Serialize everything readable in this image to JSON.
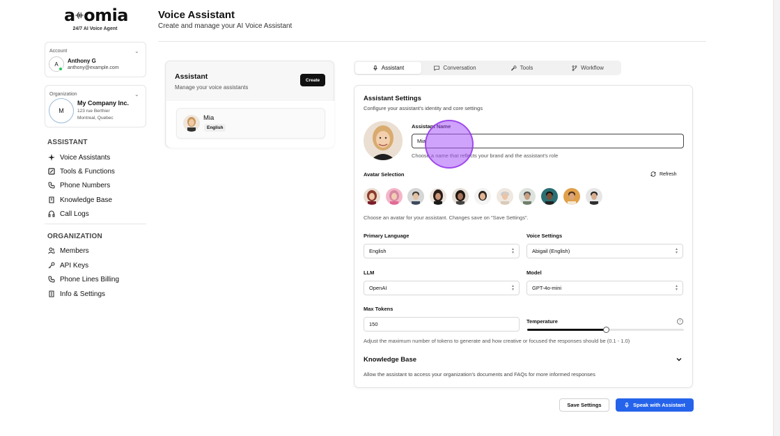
{
  "brand": {
    "logo_left": "a",
    "logo_right": "omia",
    "tagline": "24/7 AI Voice Agent"
  },
  "account": {
    "label": "Account",
    "initial": "A",
    "name": "Anthony G",
    "email": "anthony@example.com"
  },
  "organization": {
    "label": "Organization",
    "initial": "M",
    "name": "My Company Inc.",
    "address1": "123 rue Berthier",
    "address2": "Montreal, Quebec"
  },
  "nav": {
    "assistant_section": "ASSISTANT",
    "assistant_items": [
      "Voice Assistants",
      "Tools & Functions",
      "Phone Numbers",
      "Knowledge Base",
      "Call Logs"
    ],
    "org_section": "ORGANIZATION",
    "org_items": [
      "Members",
      "API Keys",
      "Phone Lines Billing",
      "Info & Settings"
    ]
  },
  "header": {
    "title": "Voice Assistant",
    "subtitle": "Create and manage your AI Voice Assistant"
  },
  "list": {
    "title": "Assistant",
    "subtitle": "Manage your voice assistants",
    "create_label": "Create",
    "items": [
      {
        "name": "Mia",
        "language": "English"
      }
    ]
  },
  "tabs": [
    "Assistant",
    "Conversation",
    "Tools",
    "Workflow"
  ],
  "settings": {
    "title": "Assistant Settings",
    "subtitle": "Configure your assistant's identity and core settings",
    "name_label": "Assistant Name",
    "name_value": "Mia",
    "name_hint": "Choose a name that reflects your brand and the assistant's role",
    "avatar_label": "Avatar Selection",
    "refresh_label": "Refresh",
    "avatar_hint": "Choose an avatar for your assistant. Changes save on \"Save Settings\".",
    "primary_language_label": "Primary Language",
    "primary_language_value": "English",
    "voice_label": "Voice Settings",
    "voice_value": "Abigail (English)",
    "llm_label": "LLM",
    "llm_value": "OpenAI",
    "model_label": "Model",
    "model_value": "GPT-4o-mini",
    "max_tokens_label": "Max Tokens",
    "max_tokens_value": "150",
    "temperature_label": "Temperature",
    "temperature_fraction": 0.5,
    "tokens_hint": "Adjust the maximum number of tokens to generate and how creative or focused the responses should be (0.1 - 1.0)",
    "kb_title": "Knowledge Base",
    "kb_subtitle": "Allow the assistant to access your organization's documents and FAQs for more informed responses"
  },
  "actions": {
    "save_label": "Save Settings",
    "speak_label": "Speak with Assistant"
  },
  "colors": {
    "accent": "#2563eb",
    "online": "#22c55e",
    "cursor": "#a855f7"
  }
}
